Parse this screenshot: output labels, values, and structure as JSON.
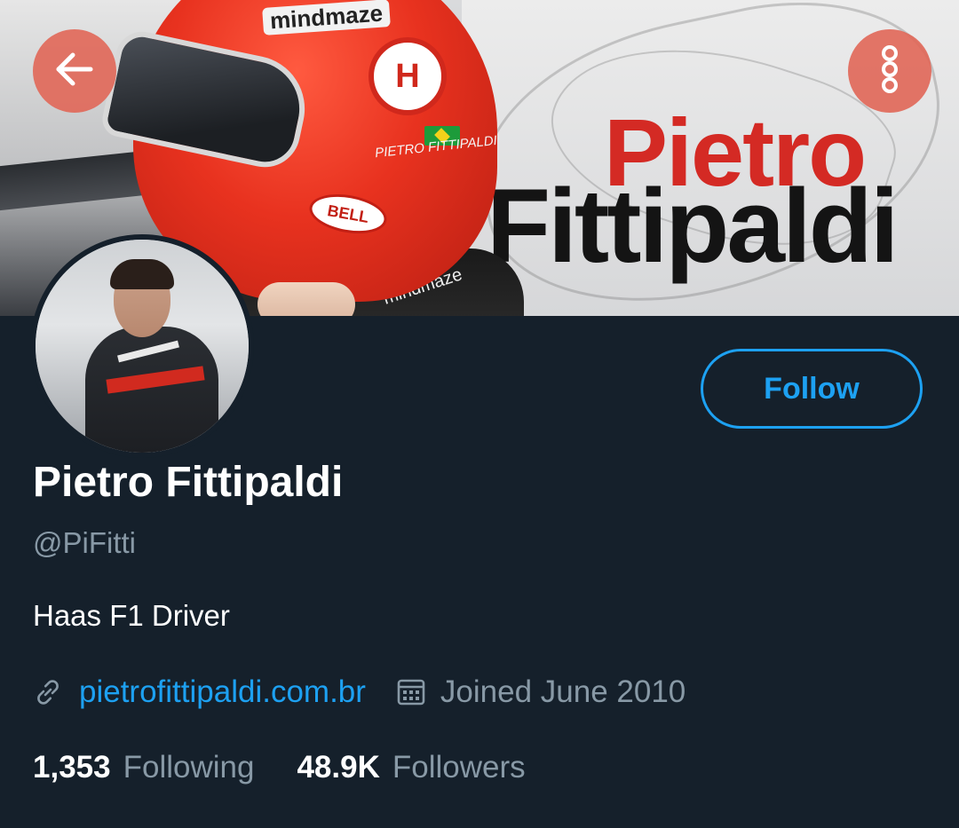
{
  "banner": {
    "name_first": "Pietro",
    "name_last": "Fittipaldi",
    "helmet_sponsor": "mindmaze",
    "helmet_badge": "H",
    "helmet_brand": "BELL",
    "helmet_name": "PIETRO FITTIPALDI",
    "suit_text": "mindmaze"
  },
  "toolbar": {
    "back_icon": "arrow-left-icon",
    "more_icon": "more-vertical-icon"
  },
  "profile": {
    "display_name": "Pietro Fittipaldi",
    "handle": "@PiFitti",
    "bio": "Haas F1 Driver",
    "website": "pietrofittipaldi.com.br",
    "joined": "Joined June 2010",
    "follow_label": "Follow"
  },
  "stats": {
    "following_count": "1,353",
    "following_label": "Following",
    "followers_count": "48.9K",
    "followers_label": "Followers"
  },
  "colors": {
    "background": "#15202b",
    "accent": "#1da1f2",
    "secondary_text": "#8899a6",
    "primary_text": "#ffffff",
    "icon_button_bg": "#e1695a"
  }
}
